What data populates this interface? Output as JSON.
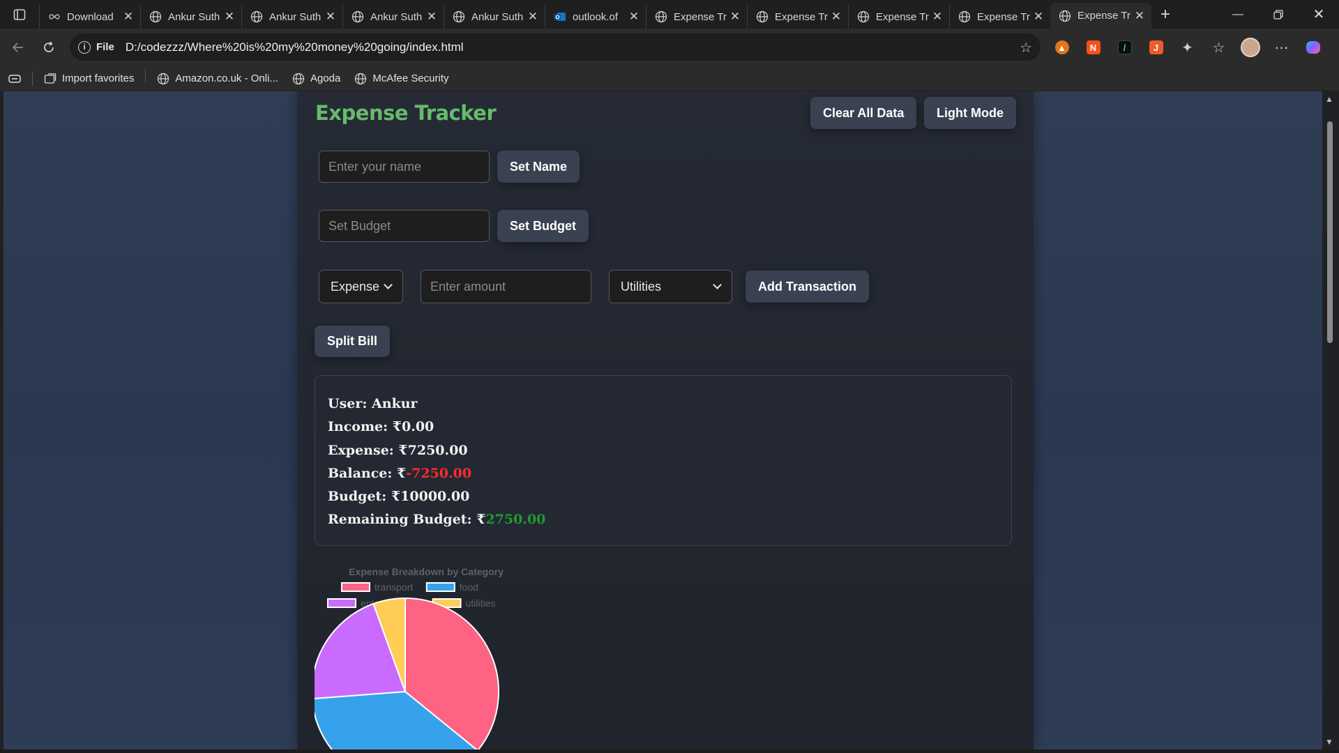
{
  "browser": {
    "tabs": [
      {
        "title": "Download",
        "icon": "infinity-icon"
      },
      {
        "title": "Ankur Suth",
        "icon": "globe-icon"
      },
      {
        "title": "Ankur Suth",
        "icon": "globe-icon"
      },
      {
        "title": "Ankur Suth",
        "icon": "globe-icon"
      },
      {
        "title": "Ankur Suth",
        "icon": "globe-icon"
      },
      {
        "title": "outlook.of",
        "icon": "outlook-icon"
      },
      {
        "title": "Expense Tr",
        "icon": "globe-icon"
      },
      {
        "title": "Expense Tr",
        "icon": "globe-icon"
      },
      {
        "title": "Expense Tr",
        "icon": "globe-icon"
      },
      {
        "title": "Expense Tr",
        "icon": "globe-icon"
      },
      {
        "title": "Expense Tr",
        "icon": "globe-icon",
        "active": true
      }
    ],
    "address": {
      "scheme": "File",
      "url": "D:/codezzz/Where%20is%20my%20money%20going/index.html"
    },
    "bookmarks": [
      {
        "label": "Import favorites",
        "icon": "import-icon"
      },
      {
        "label": "Amazon.co.uk - Onli...",
        "icon": "globe-icon"
      },
      {
        "label": "Agoda",
        "icon": "globe-icon"
      },
      {
        "label": "McAfee Security",
        "icon": "globe-icon"
      }
    ]
  },
  "app": {
    "title": "Expense Tracker",
    "clear_label": "Clear All Data",
    "theme_label": "Light Mode",
    "name_placeholder": "Enter your name",
    "set_name_label": "Set Name",
    "budget_placeholder": "Set Budget",
    "set_budget_label": "Set Budget",
    "type_select": "Expense",
    "amount_placeholder": "Enter amount",
    "category_select": "Utilities",
    "add_label": "Add Transaction",
    "split_label": "Split Bill"
  },
  "summary": {
    "user_label": "User:",
    "user": "Ankur",
    "income_label": "Income:",
    "income": "₹0.00",
    "expense_label": "Expense:",
    "expense": "₹7250.00",
    "balance_label": "Balance:",
    "balance_currency": "₹",
    "balance": "-7250.00",
    "budget_label": "Budget:",
    "budget": "₹10000.00",
    "remaining_label": "Remaining Budget:",
    "remaining_currency": "₹",
    "remaining": "2750.00",
    "negative_color": "#ff2b2b",
    "positive_color": "#1e9b2f"
  },
  "chart_data": {
    "type": "pie",
    "title": "Expense Breakdown by Category",
    "categories": [
      "transport",
      "food",
      "entertainment",
      "utilities"
    ],
    "values": [
      2600,
      2750,
      1500,
      400
    ],
    "colors": [
      "#ff6384",
      "#36a2eb",
      "#c96bff",
      "#ffcd56"
    ],
    "legend_position": "top"
  }
}
